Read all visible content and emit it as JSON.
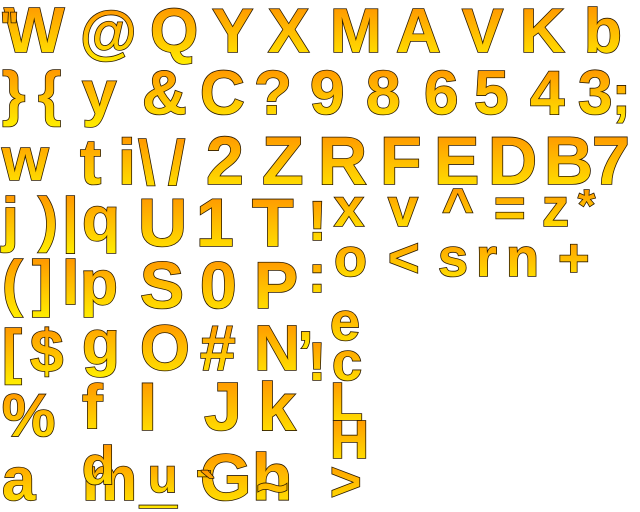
{
  "glyph_atlas": {
    "gradient": {
      "top": "#ff8a00",
      "bottom": "#ffee00"
    },
    "outline": "#2b1a00",
    "background": "#ffffff",
    "glyphs": [
      "W",
      "@",
      "Q",
      "Y",
      "X",
      "M",
      "A",
      "V",
      "K",
      "b",
      "}",
      "{",
      "y",
      "&",
      "C",
      "?",
      "9",
      "8",
      "6",
      "5",
      "4",
      "3",
      ";",
      "w",
      "t",
      "i",
      "\\",
      "/",
      "2",
      "Z",
      "R",
      "F",
      "E",
      "D",
      "B",
      "7",
      "j",
      ")",
      "|",
      "q",
      "U",
      "1",
      "T",
      "!",
      "x",
      "v",
      "^",
      "=",
      "z",
      "*",
      "(",
      "]",
      "l",
      "p",
      "S",
      "0",
      "P",
      ":",
      "o",
      "<",
      "s",
      "r",
      "n",
      "+",
      "[",
      "$",
      "g",
      "O",
      "#",
      "N",
      ",",
      "e",
      "!",
      "c",
      "%",
      "f",
      "I",
      "J",
      "k",
      "L",
      "a",
      "m",
      "d",
      "_",
      "G",
      "h",
      "H",
      ">",
      "u",
      "-",
      "`",
      "~",
      "\""
    ]
  }
}
